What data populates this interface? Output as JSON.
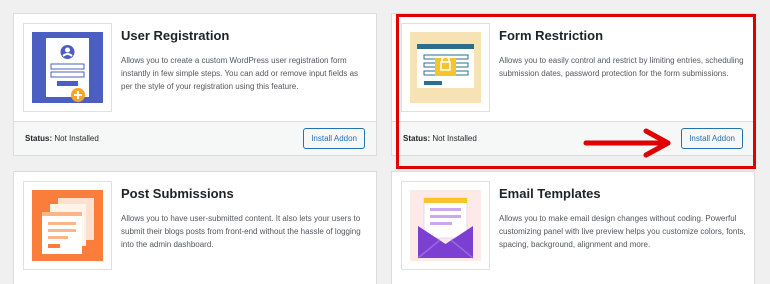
{
  "addons": [
    {
      "title": "User Registration",
      "description": "Allows you to create a custom WordPress user registration form instantly in few simple steps. You can add or remove input fields as per the style of your registration using this feature.",
      "status_label": "Status:",
      "status_value": "Not Installed",
      "button_label": "Install Addon",
      "thumb_icon": "user-registration-icon"
    },
    {
      "title": "Form Restriction",
      "description": "Allows you to easily control and restrict by limiting entries, scheduling submission dates, password protection for the form submissions.",
      "status_label": "Status:",
      "status_value": "Not Installed",
      "button_label": "Install Addon",
      "thumb_icon": "form-restriction-icon"
    },
    {
      "title": "Post Submissions",
      "description": "Allows you to have user-submitted content. It also lets your users to submit their blogs posts from front-end without the hassle of logging into the admin dashboard.",
      "thumb_icon": "post-submissions-icon"
    },
    {
      "title": "Email Templates",
      "description": "Allows you to make email design changes without coding. Powerful customizing panel with live preview helps you customize colors, fonts, spacing, background, alignment and more.",
      "thumb_icon": "email-templates-icon"
    }
  ],
  "colors": {
    "accent": "#2271b1",
    "highlight": "#e00000",
    "registration_bg": "#4a5fc1",
    "restriction_bg": "#f7e2b3",
    "submissions_bg": "#fb7d3b",
    "email_bg": "#7b3fd2"
  }
}
